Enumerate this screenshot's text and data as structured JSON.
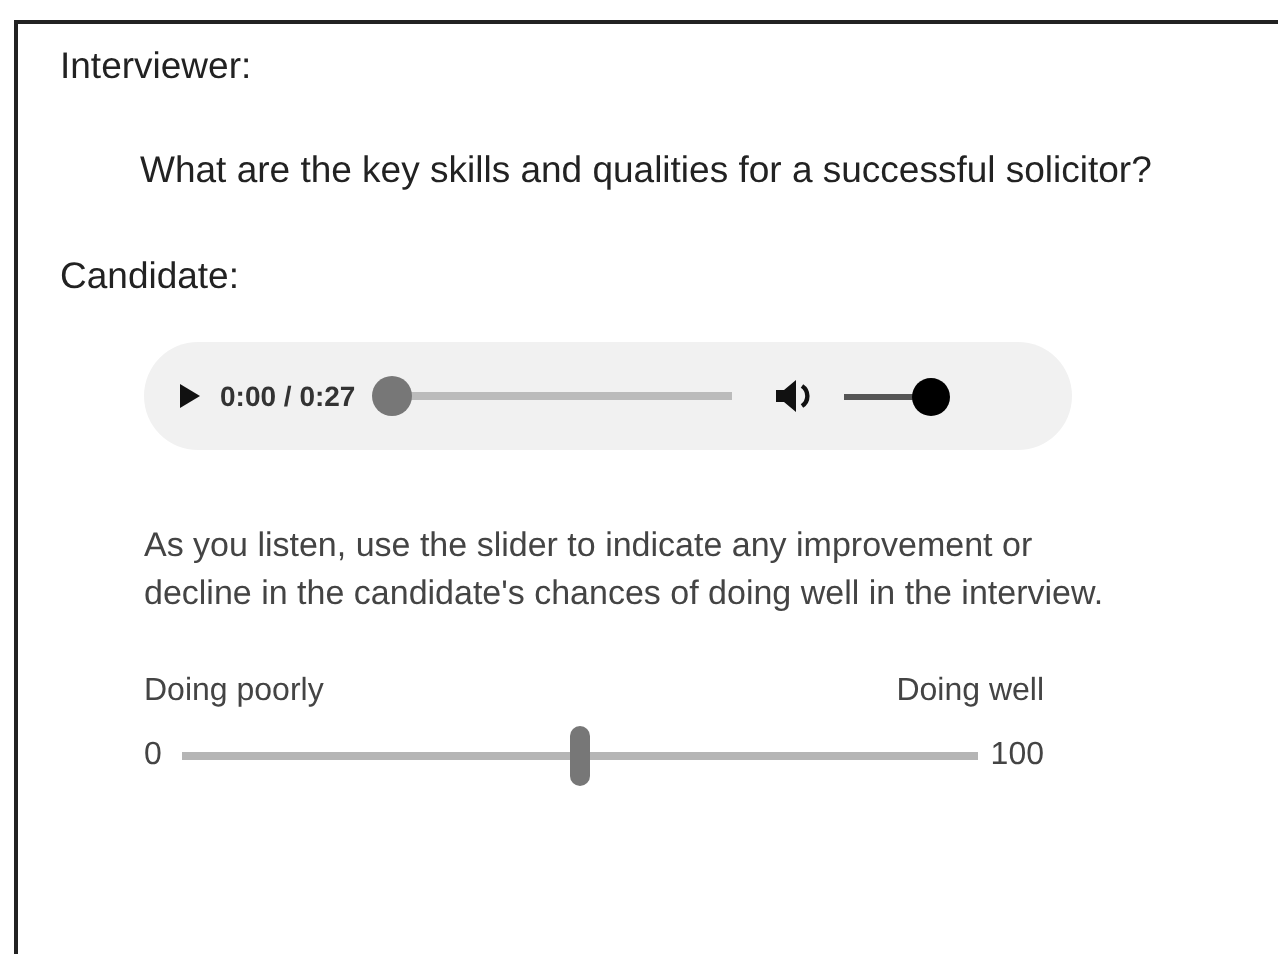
{
  "interviewer_label": "Interviewer:",
  "question": "What are the key skills and qualities for a successful solicitor?",
  "candidate_label": "Candidate:",
  "audio_player": {
    "time": "0:00 / 0:27",
    "progress": {
      "level": 0
    },
    "volume": {
      "level": 1
    }
  },
  "instructions": "As you listen, use the slider to indicate any improvement or decline in the candidate's chances of doing well in the interview.",
  "rating_slider": {
    "low_label": "Doing poorly",
    "high_label": "Doing well",
    "min": "0",
    "max": "100",
    "level": 0.5
  }
}
